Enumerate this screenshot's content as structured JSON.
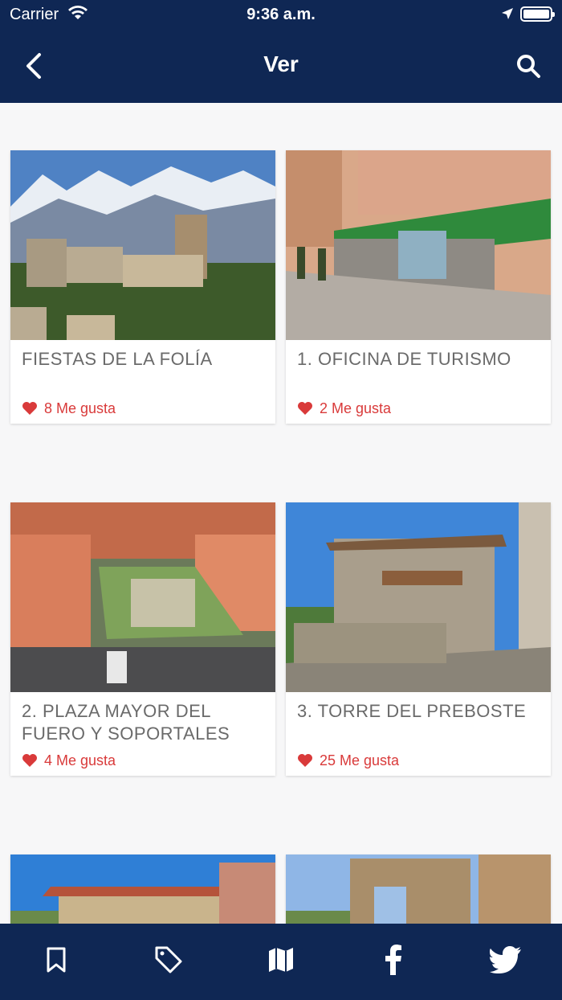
{
  "status_bar": {
    "carrier": "Carrier",
    "time": "9:36 a.m."
  },
  "nav": {
    "title": "Ver",
    "back_icon": "chevron-left-icon",
    "search_icon": "search-icon"
  },
  "colors": {
    "header_bg": "#0f2754",
    "like_red": "#d93a3a",
    "title_gray": "#6a6a6a"
  },
  "cards": [
    {
      "title": "FIESTAS DE LA FOLÍA",
      "likes": "8 Me gusta",
      "image": "village with mountains"
    },
    {
      "title": "1. OFICINA DE TURISMO",
      "likes": "2 Me gusta",
      "image": "tourist office street"
    },
    {
      "title": "2. PLAZA MAYOR DEL FUERO Y SOPORTALES",
      "likes": "4 Me gusta",
      "image": "aerial plaza"
    },
    {
      "title": "3. TORRE DEL PREBOSTE",
      "likes": "25 Me gusta",
      "image": "stone tower"
    },
    {
      "title": "",
      "likes": "",
      "image": "building with red roof"
    },
    {
      "title": "",
      "likes": "",
      "image": "stone ruins"
    }
  ],
  "tabbar": {
    "items": [
      "bookmark-icon",
      "tag-icon",
      "map-icon",
      "facebook-icon",
      "twitter-icon"
    ]
  }
}
